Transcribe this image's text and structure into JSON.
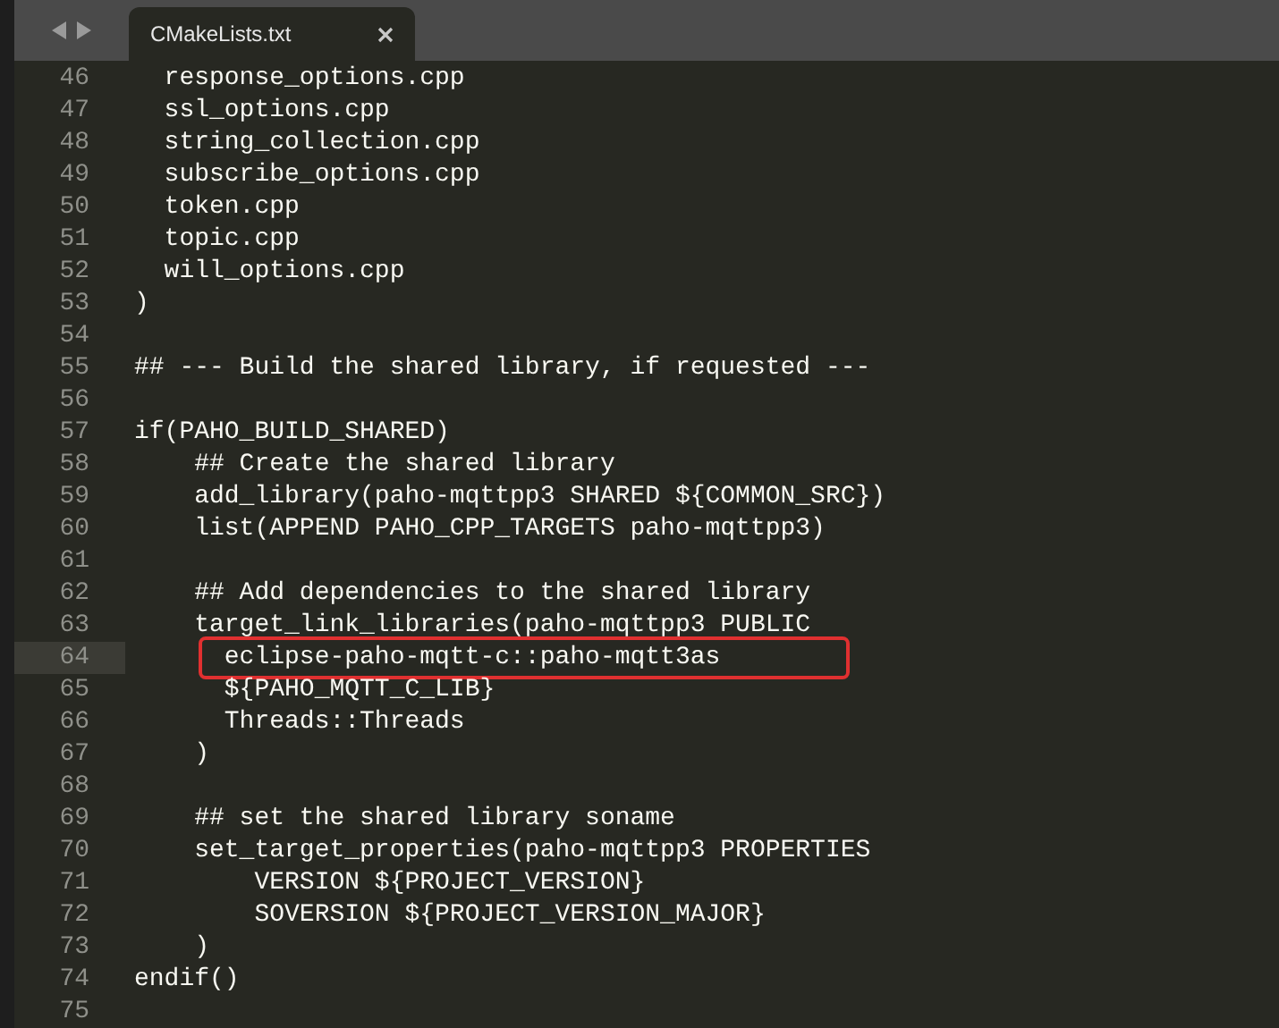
{
  "tabs": [
    {
      "title": "CMakeLists.txt",
      "selected": true
    }
  ],
  "lines": [
    {
      "number": "46",
      "text": "  response_options.cpp",
      "current": false,
      "boxed": false
    },
    {
      "number": "47",
      "text": "  ssl_options.cpp",
      "current": false,
      "boxed": false
    },
    {
      "number": "48",
      "text": "  string_collection.cpp",
      "current": false,
      "boxed": false
    },
    {
      "number": "49",
      "text": "  subscribe_options.cpp",
      "current": false,
      "boxed": false
    },
    {
      "number": "50",
      "text": "  token.cpp",
      "current": false,
      "boxed": false
    },
    {
      "number": "51",
      "text": "  topic.cpp",
      "current": false,
      "boxed": false
    },
    {
      "number": "52",
      "text": "  will_options.cpp",
      "current": false,
      "boxed": false
    },
    {
      "number": "53",
      "text": ")",
      "current": false,
      "boxed": false
    },
    {
      "number": "54",
      "current": false,
      "boxed": false
    },
    {
      "number": "55",
      "text": "## --- Build the shared library, if requested ---",
      "current": false,
      "boxed": false
    },
    {
      "number": "56",
      "current": false,
      "boxed": false
    },
    {
      "number": "57",
      "text": "if(PAHO_BUILD_SHARED)",
      "current": false,
      "boxed": false
    },
    {
      "number": "58",
      "text": "    ## Create the shared library",
      "current": false,
      "boxed": false
    },
    {
      "number": "59",
      "text": "    add_library(paho-mqttpp3 SHARED ${COMMON_SRC})",
      "current": false,
      "boxed": false
    },
    {
      "number": "60",
      "text": "    list(APPEND PAHO_CPP_TARGETS paho-mqttpp3)",
      "current": false,
      "boxed": false
    },
    {
      "number": "61",
      "current": false,
      "boxed": false
    },
    {
      "number": "62",
      "text": "    ## Add dependencies to the shared library",
      "current": false,
      "boxed": false
    },
    {
      "number": "63",
      "text": "    target_link_libraries(paho-mqttpp3 PUBLIC",
      "current": false,
      "boxed": false
    },
    {
      "number": "64",
      "text": "      eclipse-paho-mqtt-c::paho-mqtt3as",
      "current": true,
      "boxed": true
    },
    {
      "number": "65",
      "text": "      ${PAHO_MQTT_C_LIB}",
      "current": false,
      "boxed": false
    },
    {
      "number": "66",
      "text": "      Threads::Threads",
      "current": false,
      "boxed": false
    },
    {
      "number": "67",
      "text": "    )",
      "current": false,
      "boxed": false
    },
    {
      "number": "68",
      "current": false,
      "boxed": false
    },
    {
      "number": "69",
      "text": "    ## set the shared library soname",
      "current": false,
      "boxed": false
    },
    {
      "number": "70",
      "text": "    set_target_properties(paho-mqttpp3 PROPERTIES",
      "current": false,
      "boxed": false
    },
    {
      "number": "71",
      "text": "        VERSION ${PROJECT_VERSION}",
      "current": false,
      "boxed": false
    },
    {
      "number": "72",
      "text": "        SOVERSION ${PROJECT_VERSION_MAJOR}",
      "current": false,
      "boxed": false
    },
    {
      "number": "73",
      "text": "    )",
      "current": false,
      "boxed": false
    },
    {
      "number": "74",
      "text": "endif()",
      "current": false,
      "boxed": false
    },
    {
      "number": "75",
      "current": false,
      "boxed": false
    }
  ]
}
